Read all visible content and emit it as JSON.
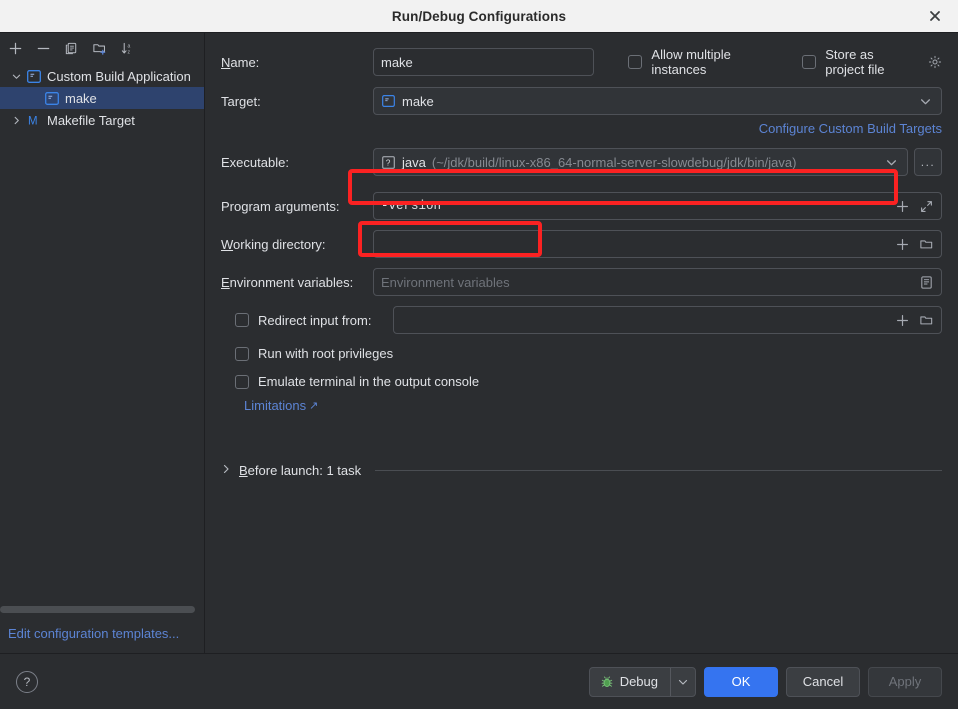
{
  "window": {
    "title": "Run/Debug Configurations",
    "close_icon": "close-icon"
  },
  "sidebar": {
    "toolbar": [
      {
        "name": "add-configuration-button",
        "icon": "plus-icon"
      },
      {
        "name": "remove-configuration-button",
        "icon": "minus-icon"
      },
      {
        "name": "copy-configuration-button",
        "icon": "copy-icon"
      },
      {
        "name": "new-folder-button",
        "icon": "folder-add-icon"
      },
      {
        "name": "sort-configurations-button",
        "icon": "sort-alpha-icon"
      }
    ],
    "tree": [
      {
        "label": "Custom Build Application",
        "icon": "console-app-icon",
        "expanded": true,
        "twisty": "⌄",
        "depth": 0,
        "selected": false
      },
      {
        "label": "make",
        "icon": "console-app-icon",
        "depth": 1,
        "selected": true
      },
      {
        "label": "Makefile Target",
        "icon": "makefile-m-icon",
        "expanded": false,
        "twisty": "›",
        "depth": 0,
        "selected": false
      }
    ],
    "footer_link": "Edit configuration templates..."
  },
  "form": {
    "name": {
      "label_prefix": "N",
      "label_rest": "ame:",
      "value": "make"
    },
    "allow_multiple_instances": {
      "label": "Allow multiple instances",
      "checked": false
    },
    "store_as_project_file": {
      "label": "Store as project file",
      "checked": false,
      "gear_icon": "gear-icon"
    },
    "target": {
      "label": "Target:",
      "value": "make",
      "icon": "console-app-icon"
    },
    "configure_link": "Configure Custom Build Targets",
    "executable": {
      "label": "Executable:",
      "value": "java",
      "hint": "(~/jdk/build/linux-x86_64-normal-server-slowdebug/jdk/bin/java)",
      "icon": "unknown-question-icon",
      "browse_label": "..."
    },
    "program_arguments": {
      "label_prefix": "",
      "label": "Program arguments:",
      "value": "-version",
      "add_icon": "plus-icon",
      "expand_icon": "expand-diagonal-icon"
    },
    "working_directory": {
      "label_prefix": "W",
      "label_rest": "orking directory:",
      "value": "",
      "add_icon": "plus-icon",
      "browse_icon": "folder-icon"
    },
    "environment_variables": {
      "label_prefix": "E",
      "label_rest": "nvironment variables:",
      "value": "",
      "placeholder": "Environment variables",
      "edit_icon": "list-edit-icon"
    },
    "redirect_input": {
      "label": "Redirect input from:",
      "checked": false,
      "value": "",
      "add_icon": "plus-icon",
      "browse_icon": "folder-icon"
    },
    "run_with_root": {
      "label": "Run with root privileges",
      "checked": false
    },
    "emulate_terminal": {
      "label": "Emulate terminal in the output console",
      "checked": false
    },
    "limitations_link": "Limitations",
    "limitations_arrow": "↗",
    "before_launch": {
      "label_prefix": "B",
      "label_rest": "efore launch: 1 task",
      "arrow": "›",
      "expanded": false
    }
  },
  "footer": {
    "help_label": "?",
    "debug_label": "Debug",
    "debug_icon": "bug-icon",
    "debug_dropdown": "⌄",
    "ok_label": "OK",
    "cancel_label": "Cancel",
    "apply_label": "Apply",
    "apply_disabled": true
  },
  "annotations": {
    "highlight_color": "#fb2222",
    "boxes": [
      {
        "name": "executable-field-highlight"
      },
      {
        "name": "program-arguments-highlight"
      }
    ]
  },
  "colors": {
    "background": "#2b2d30",
    "field_background": "#313438",
    "accent_blue": "#3574f0",
    "link_blue": "#5c84d4",
    "selection": "#2e436e",
    "title_bar": "#f2f2f2"
  }
}
